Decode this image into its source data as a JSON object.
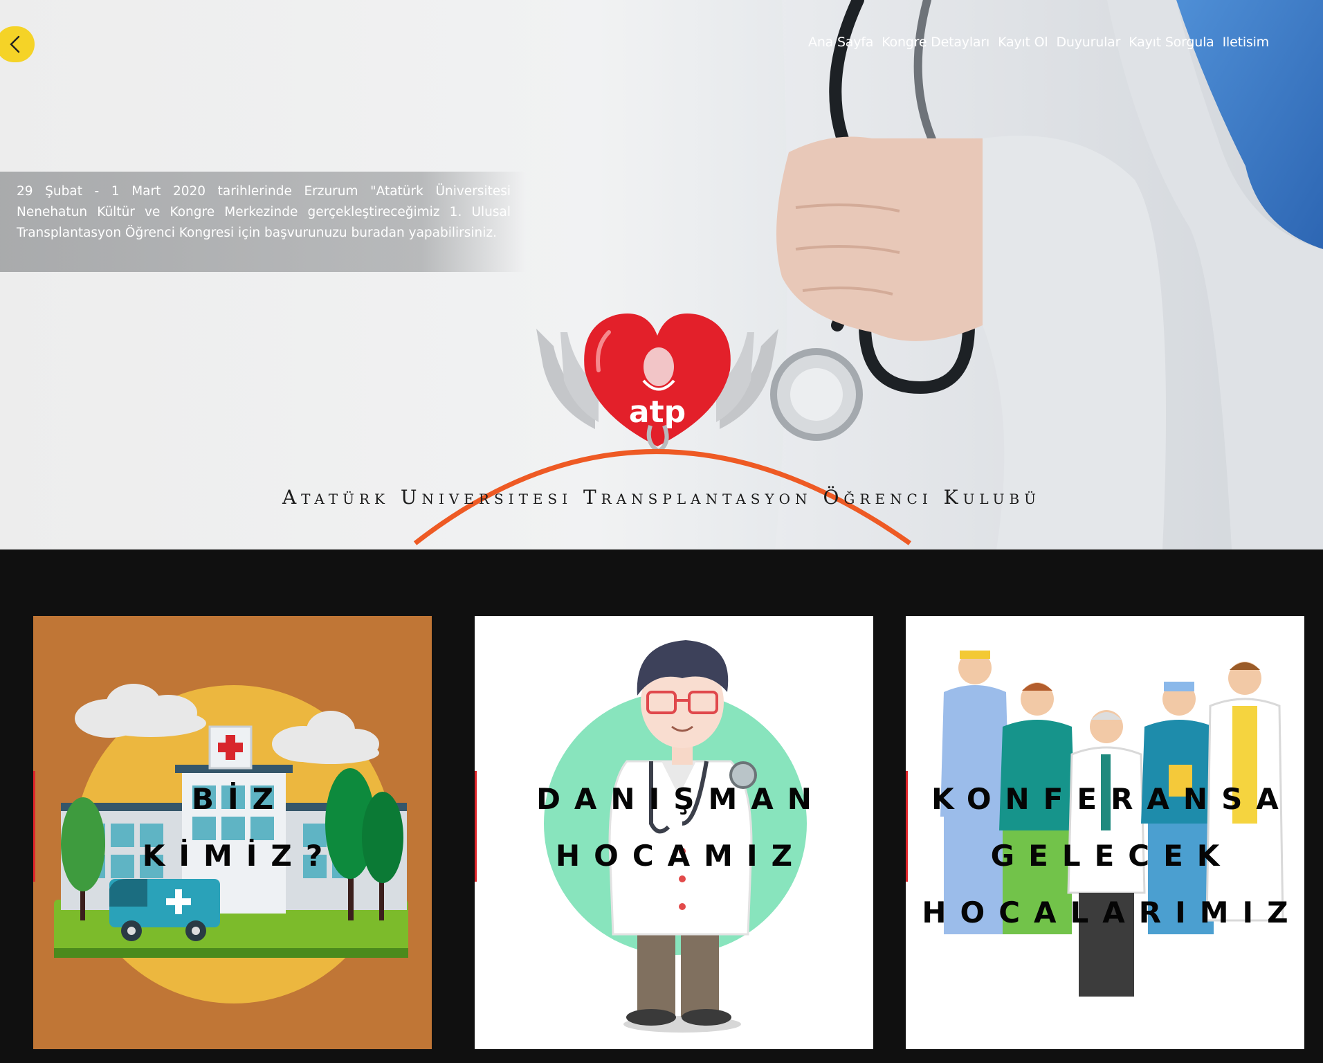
{
  "nav": {
    "back_icon": "chevron-left-icon",
    "items": [
      "Ana Sayfa",
      "Kongre Detayları",
      "Kayıt Ol",
      "Duyurular",
      "Kayıt Sorgula",
      "Iletisim"
    ]
  },
  "hero": {
    "intro_text": "29 Şubat - 1 Mart 2020 tarihlerinde Erzurum \"Atatürk Üniversitesi Nenehatun Kültür ve Kongre Merkezinde gerçekleştireceğimiz 1. Ulusal Transplantasyon Öğrenci Kongresi için başvurunuzu buradan yapabilirsiniz.",
    "logo_text": "atp",
    "club_name": "Atatürk Universitesi Transplantasyon Öğrenci Kulubü"
  },
  "cards": [
    {
      "line1": "BİZ",
      "line2": "KİMİZ?",
      "line3": ""
    },
    {
      "line1": "DANIŞMAN",
      "line2": "HOCAMIZ",
      "line3": ""
    },
    {
      "line1": "KONFERANSA",
      "line2": "GELECEK",
      "line3": "HOCALARIMIZ"
    }
  ],
  "colors": {
    "back_button": "#f5d327",
    "heart": "#e3202a",
    "arc": "#ee5a24",
    "card1_bg": "#c07636",
    "accent_bar": "#e0262b"
  }
}
